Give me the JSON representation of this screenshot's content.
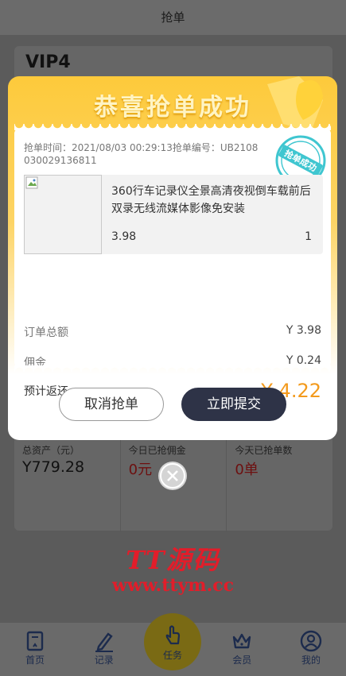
{
  "header": {
    "title": "抢单"
  },
  "account": {
    "level": "VIP4"
  },
  "stats": [
    {
      "label": "总资产（元）",
      "value": "Y779.28"
    },
    {
      "label": "今日已抢佣金",
      "value": "0元"
    },
    {
      "label": "今天已抢单数",
      "value": "0单"
    }
  ],
  "watermark": {
    "title": "TT源码",
    "url": "www.ttym.cc"
  },
  "nav": {
    "home": "首页",
    "records": "记录",
    "task": "任务",
    "member": "会员",
    "mine": "我的"
  },
  "modal": {
    "title": "恭喜抢单成功",
    "stamp_text": "抢单成功",
    "order_info": "抢单时间：2021/08/03 00:29:13抢单编号：UB2108030029136811",
    "product": {
      "name": "360行车记录仪全景高清夜视倒车载前后双录无线流媒体影像免安装",
      "price": "3.98",
      "quantity": "1"
    },
    "total_label": "订单总额",
    "total_value": "Y 3.98",
    "commission_label": "佣金",
    "commission_value": "Y 0.24",
    "return_label": "预计返还",
    "return_value": "Y 4.22",
    "cancel_label": "取消抢单",
    "submit_label": "立即提交"
  },
  "colors": {
    "accent": "#f39a1c",
    "modal_top": "#fdca3b",
    "submit_button": "#2e3347",
    "watermark": "#e21d2a"
  }
}
